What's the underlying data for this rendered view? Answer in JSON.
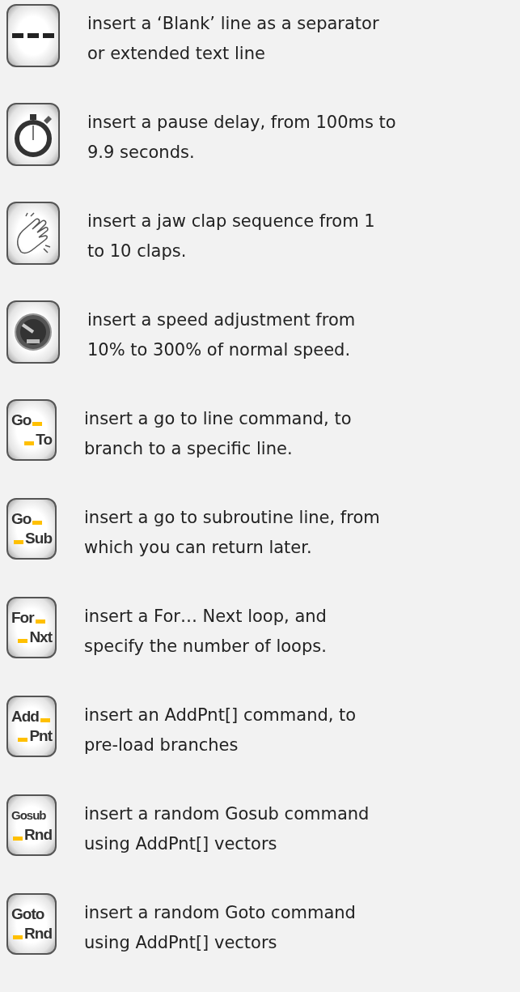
{
  "commands": [
    {
      "kind": "dash",
      "lines": [
        "insert a ‘Blank’ line as a separator",
        "or extended text line"
      ]
    },
    {
      "kind": "stopwatch",
      "lines": [
        "insert a pause delay, from 100ms to",
        "9.9 seconds."
      ]
    },
    {
      "kind": "clap",
      "lines": [
        "insert a jaw clap sequence from 1",
        "to 10 claps."
      ]
    },
    {
      "kind": "gauge",
      "lines": [
        "insert a speed adjustment from",
        "10% to 300% of normal speed."
      ]
    },
    {
      "kind": "label",
      "top": "Go",
      "bottom": "To",
      "top_dash": true,
      "bottom_dash": true,
      "lines": [
        "insert a go to line command, to",
        "branch to a specific line."
      ]
    },
    {
      "kind": "label",
      "top": "Go",
      "bottom": "Sub",
      "top_dash": true,
      "bottom_dash": true,
      "lines": [
        "insert a go to subroutine line, from",
        "which you can return later."
      ]
    },
    {
      "kind": "label",
      "top": "For",
      "bottom": "Nxt",
      "top_dash": true,
      "bottom_dash": true,
      "lines": [
        "insert a For… Next loop, and",
        "specify the number of loops."
      ]
    },
    {
      "kind": "label",
      "top": "Add",
      "bottom": "Pnt",
      "top_dash": true,
      "bottom_dash": true,
      "lines": [
        "insert an AddPnt[] command, to",
        "pre-load branches"
      ]
    },
    {
      "kind": "label",
      "top": "Gosub",
      "bottom": "Rnd",
      "top_dash": false,
      "bottom_dash": true,
      "lines": [
        "insert a random Gosub command",
        "using AddPnt[] vectors"
      ]
    },
    {
      "kind": "label",
      "top": "Goto",
      "bottom": "Rnd",
      "top_dash": false,
      "bottom_dash": true,
      "lines": [
        "insert a random Goto command",
        "using AddPnt[] vectors"
      ]
    }
  ]
}
